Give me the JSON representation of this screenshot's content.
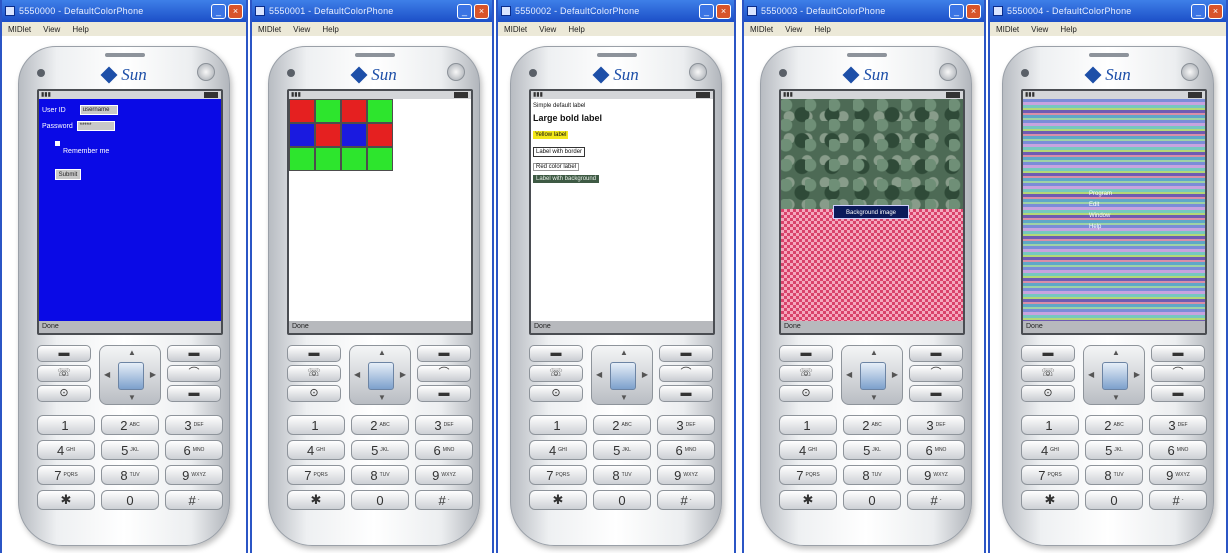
{
  "windows": [
    {
      "title": "5550000 - DefaultColorPhone",
      "menu": [
        "MIDlet",
        "View",
        "Help"
      ],
      "softkey": "Done"
    },
    {
      "title": "5550001 - DefaultColorPhone",
      "menu": [
        "MIDlet",
        "View",
        "Help"
      ],
      "softkey": "Done"
    },
    {
      "title": "5550002 - DefaultColorPhone",
      "menu": [
        "MIDlet",
        "View",
        "Help"
      ],
      "softkey": "Done"
    },
    {
      "title": "5550003 - DefaultColorPhone",
      "menu": [
        "MIDlet",
        "View",
        "Help"
      ],
      "softkey": "Done"
    },
    {
      "title": "5550004 - DefaultColorPhone",
      "menu": [
        "MIDlet",
        "View",
        "Help"
      ],
      "softkey": "Done"
    }
  ],
  "phone": {
    "brand": "Sun",
    "keys": [
      {
        "digit": "1",
        "letters": ""
      },
      {
        "digit": "2",
        "letters": "ABC"
      },
      {
        "digit": "3",
        "letters": "DEF"
      },
      {
        "digit": "4",
        "letters": "GHI"
      },
      {
        "digit": "5",
        "letters": "JKL"
      },
      {
        "digit": "6",
        "letters": "MNO"
      },
      {
        "digit": "7",
        "letters": "PQRS"
      },
      {
        "digit": "8",
        "letters": "TUV"
      },
      {
        "digit": "9",
        "letters": "WXYZ"
      },
      {
        "digit": "✱",
        "letters": ""
      },
      {
        "digit": "0",
        "letters": ""
      },
      {
        "digit": "#",
        "letters": "-"
      }
    ]
  },
  "screen1": {
    "user_label": "User ID",
    "user_value": "username",
    "password_label": "Password",
    "password_value": "*****",
    "remember_label": "Remember me",
    "button_label": "Submit",
    "bg_color": "#0a0ae6"
  },
  "screen2": {
    "colors": [
      "#e52020",
      "#2de52d",
      "#e52020",
      "#2de52d",
      "#1a1ae0",
      "#e52020",
      "#1a1ae0",
      "#e52020",
      "#2de52d",
      "#2de52d",
      "#2de52d",
      "#2de52d"
    ]
  },
  "screen3": {
    "items": [
      "Simple default label",
      "Large bold label",
      "Yellow label",
      "Label with border",
      "Red color label",
      "Label with background"
    ]
  },
  "screen4": {
    "label": "Background image"
  },
  "screen5": {
    "menu": [
      "Program",
      "Edit",
      "Window",
      "Help"
    ]
  }
}
